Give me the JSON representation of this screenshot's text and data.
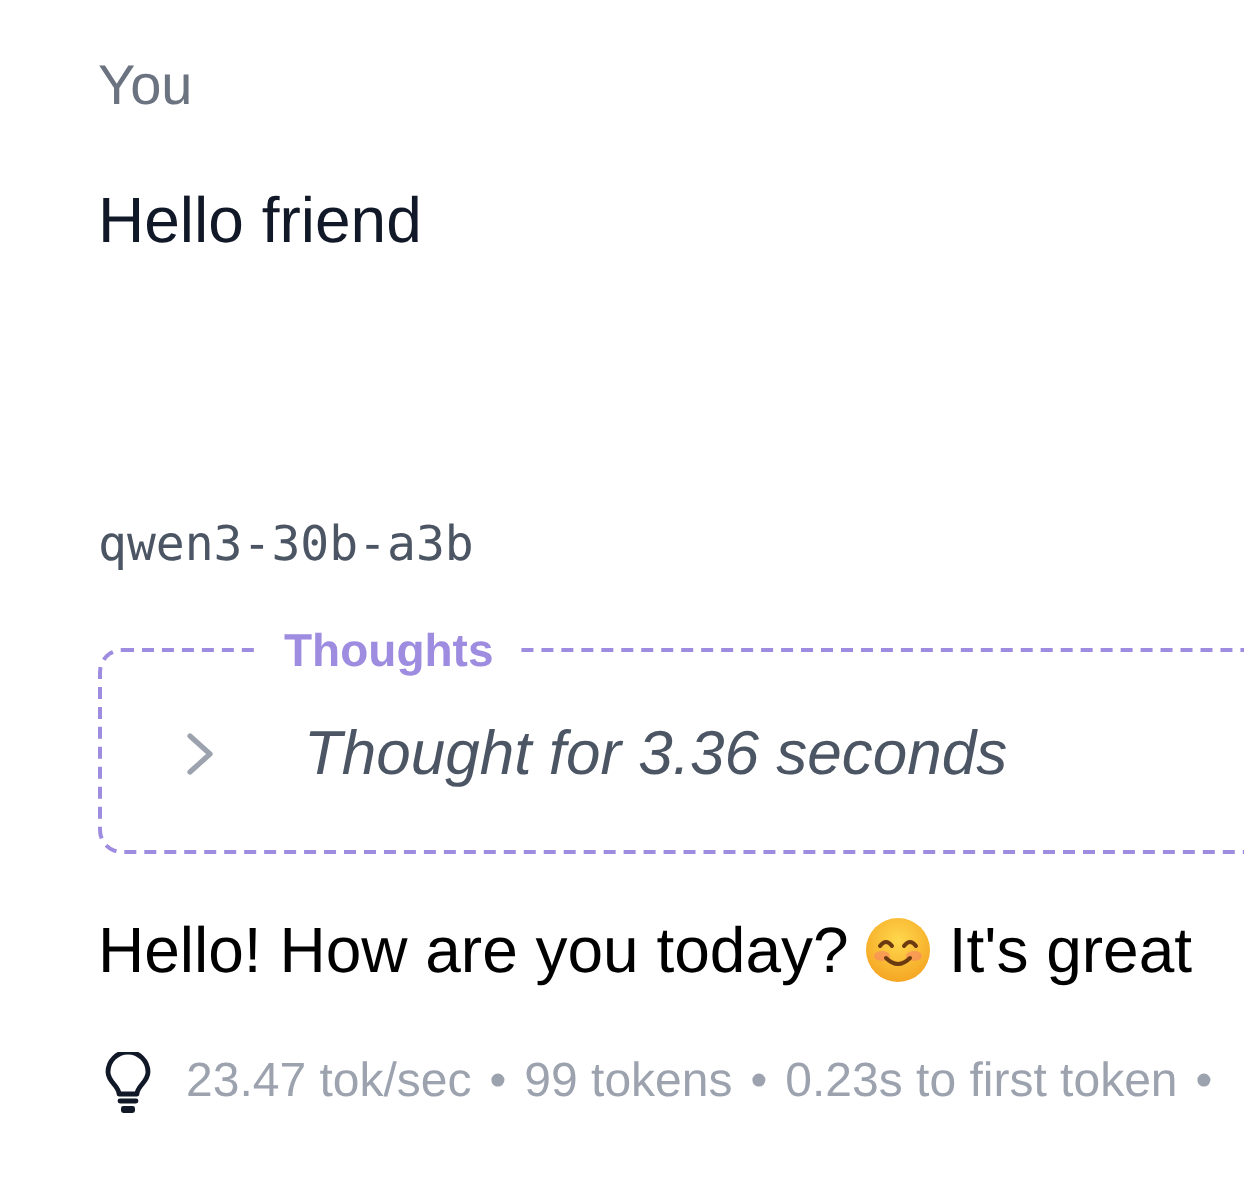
{
  "sender": {
    "name": "You",
    "message": "Hello friend"
  },
  "response": {
    "model": "qwen3-30b-a3b",
    "thoughts": {
      "legend": "Thoughts",
      "expanded": false,
      "summary": "Thought for 3.36 seconds"
    },
    "message": [
      {
        "kind": "text",
        "text": "Hello! How are you today?"
      },
      {
        "kind": "emoji"
      },
      {
        "kind": "text",
        "text": "It's great"
      }
    ],
    "stats": {
      "items": [
        "23.47 tok/sec",
        "99 tokens",
        "0.23s to first token"
      ],
      "separator": "•"
    }
  }
}
